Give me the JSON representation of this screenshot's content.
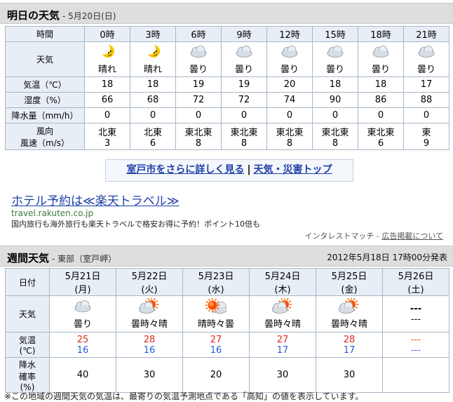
{
  "tomorrow": {
    "title": "明日の天気",
    "date": "- 5月20日(日)",
    "labels": {
      "time": "時間",
      "weather": "天気",
      "temp": "気温（℃）",
      "humidity": "湿度（%）",
      "precip": "降水量（mm/h）",
      "wind_dir": "風向",
      "wind_speed": "風速（m/s）"
    },
    "columns": [
      {
        "time": "0時",
        "icon": "moon-clear",
        "weather": "晴れ",
        "temp": "18",
        "humidity": "66",
        "precip": "0",
        "wind_dir": "北東",
        "wind_speed": "3"
      },
      {
        "time": "3時",
        "icon": "moon-clear",
        "weather": "晴れ",
        "temp": "18",
        "humidity": "68",
        "precip": "0",
        "wind_dir": "北東",
        "wind_speed": "6"
      },
      {
        "time": "6時",
        "icon": "cloud",
        "weather": "曇り",
        "temp": "19",
        "humidity": "72",
        "precip": "0",
        "wind_dir": "東北東",
        "wind_speed": "8"
      },
      {
        "time": "9時",
        "icon": "cloud",
        "weather": "曇り",
        "temp": "19",
        "humidity": "72",
        "precip": "0",
        "wind_dir": "東北東",
        "wind_speed": "8"
      },
      {
        "time": "12時",
        "icon": "cloud",
        "weather": "曇り",
        "temp": "20",
        "humidity": "74",
        "precip": "0",
        "wind_dir": "東北東",
        "wind_speed": "8"
      },
      {
        "time": "15時",
        "icon": "cloud",
        "weather": "曇り",
        "temp": "18",
        "humidity": "90",
        "precip": "0",
        "wind_dir": "東北東",
        "wind_speed": "8"
      },
      {
        "time": "18時",
        "icon": "cloud",
        "weather": "曇り",
        "temp": "18",
        "humidity": "86",
        "precip": "0",
        "wind_dir": "東北東",
        "wind_speed": "6"
      },
      {
        "time": "21時",
        "icon": "cloud",
        "weather": "曇り",
        "temp": "17",
        "humidity": "88",
        "precip": "0",
        "wind_dir": "東",
        "wind_speed": "9"
      }
    ]
  },
  "links": {
    "detail": "室戸市をさらに詳しく見る",
    "separator": "|",
    "top": "天気・災害トップ"
  },
  "ad": {
    "title": "ホテル予約は≪楽天トラベル≫",
    "url": "travel.rakuten.co.jp",
    "desc": "国内旅行も海外旅行も楽天トラベルで格安お得に予約！ポイント10倍も",
    "sponsor": "インタレストマッチ",
    "sponsor_sep": " - ",
    "ad_link": "広告掲載について"
  },
  "weekly": {
    "title": "週間天気",
    "region": "- 東部（室戸岬）",
    "issued": "2012年5月18日 17時00分発表",
    "labels": {
      "date": "日付",
      "weather": "天気",
      "temp_line1": "気温",
      "temp_line2": "(℃)",
      "pop_line1": "降水",
      "pop_line2": "確率",
      "pop_line3": "(%)"
    },
    "days": [
      {
        "date": "5月21日",
        "dow": "(月)",
        "icon": "cloud",
        "weather": "曇り",
        "high": "25",
        "low": "16",
        "pop": "40"
      },
      {
        "date": "5月22日",
        "dow": "(火)",
        "icon": "cloud-sun",
        "weather": "曇時々晴",
        "high": "28",
        "low": "16",
        "pop": "30"
      },
      {
        "date": "5月23日",
        "dow": "(水)",
        "icon": "sun-cloud",
        "weather": "晴時々曇",
        "high": "27",
        "low": "16",
        "pop": "20"
      },
      {
        "date": "5月24日",
        "dow": "(木)",
        "icon": "cloud-sun",
        "weather": "曇時々晴",
        "high": "27",
        "low": "17",
        "pop": "30"
      },
      {
        "date": "5月25日",
        "dow": "(金)",
        "icon": "cloud-sun",
        "weather": "曇時々晴",
        "high": "28",
        "low": "17",
        "pop": "30"
      },
      {
        "date": "5月26日",
        "dow": "(土)",
        "icon": "none",
        "weather": "---",
        "weather2": "---",
        "high": "---",
        "low": "---",
        "pop": ""
      }
    ]
  },
  "footer": {
    "note": "※この地域の週間天気の気温は、最寄りの気温予測地点である「高知」の値を表示しています。"
  }
}
